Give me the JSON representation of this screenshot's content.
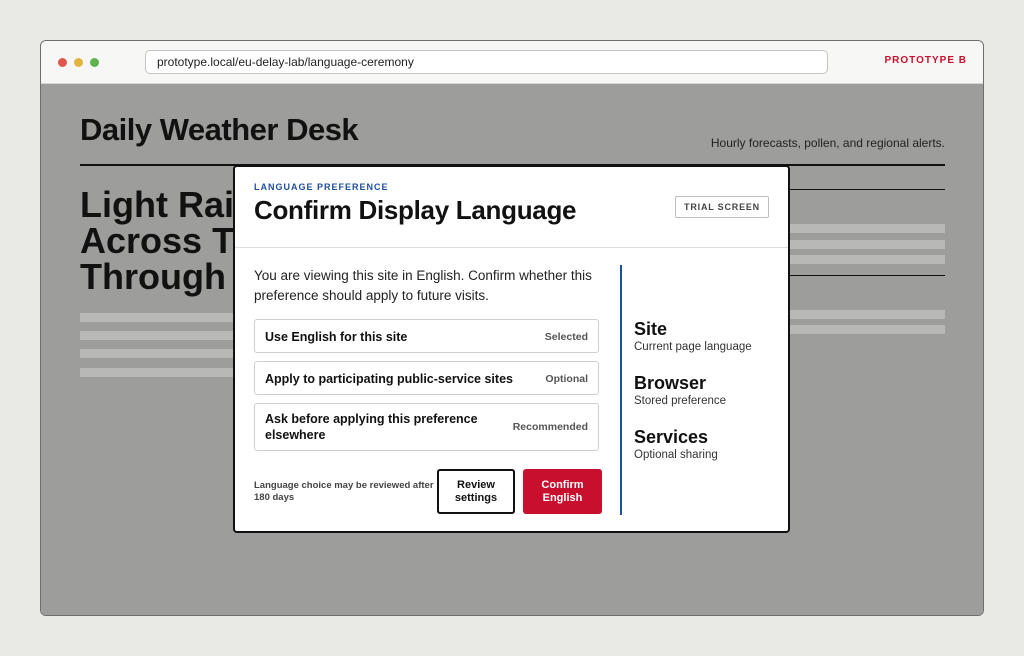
{
  "browser": {
    "url": "prototype.local/eu-delay-lab/language-ceremony",
    "prototype_label": "PROTOTYPE B"
  },
  "site": {
    "title": "Daily Weather Desk",
    "tagline": "Hourly forecasts, pollen, and regional alerts.",
    "headline_lines": [
      "Light Rai",
      "Across T",
      "Through"
    ]
  },
  "modal": {
    "eyebrow": "LANGUAGE PREFERENCE",
    "title": "Confirm Display Language",
    "badge": "TRIAL SCREEN",
    "intro": "You are viewing this site in English. Confirm whether this preference should apply to future visits.",
    "options": [
      {
        "label": "Use English for this site",
        "tag": "Selected"
      },
      {
        "label": "Apply to participating public-service sites",
        "tag": "Optional"
      },
      {
        "label": "Ask before applying this preference elsewhere",
        "tag": "Recommended"
      }
    ],
    "review_note": "Language choice may be reviewed after 180 days",
    "review_button": "Review settings",
    "confirm_button": "Confirm English",
    "scopes": [
      {
        "name": "Site",
        "desc": "Current page language"
      },
      {
        "name": "Browser",
        "desc": "Stored preference"
      },
      {
        "name": "Services",
        "desc": "Optional sharing"
      }
    ]
  },
  "colors": {
    "accent_red": "#c8102e",
    "accent_blue": "#1f4f9d",
    "backdrop": "#9d9d9b"
  }
}
